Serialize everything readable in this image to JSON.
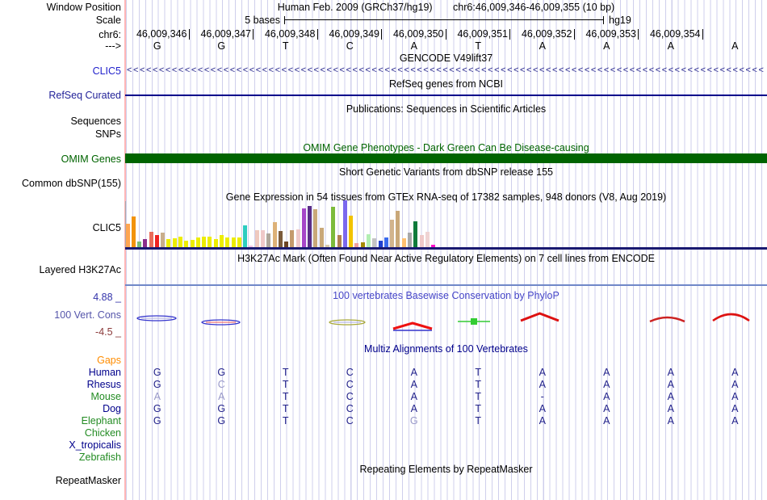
{
  "header": {
    "assembly": "Human Feb. 2009 (GRCh37/hg19)",
    "window": "chr6:46,009,346-46,009,355 (10 bp)"
  },
  "ruler": {
    "scale_text": "5 bases",
    "genome": "hg19",
    "coordinates": [
      "46,009,346",
      "46,009,347",
      "46,009,348",
      "46,009,349",
      "46,009,350",
      "46,009,351",
      "46,009,352",
      "46,009,353",
      "46,009,354"
    ],
    "bases": [
      "G",
      "G",
      "T",
      "C",
      "A",
      "T",
      "A",
      "A",
      "A",
      "A"
    ]
  },
  "left_labels": [
    {
      "id": "window-position",
      "text": "Window Position",
      "color": "#000000",
      "y": 2
    },
    {
      "id": "scale",
      "text": "Scale",
      "color": "#000000",
      "y": 18
    },
    {
      "id": "chrom",
      "text": "chr6:",
      "color": "#000000",
      "y": 36
    },
    {
      "id": "strand",
      "text": "--->",
      "color": "#000000",
      "y": 50
    },
    {
      "id": "clic5-gencode",
      "text": "CLIC5",
      "color": "#2222CC",
      "y": 81
    },
    {
      "id": "refseq-curated",
      "text": "RefSeq Curated",
      "color": "#222299",
      "y": 111
    },
    {
      "id": "sequences",
      "text": "Sequences",
      "color": "#000000",
      "y": 143
    },
    {
      "id": "snps",
      "text": "SNPs",
      "color": "#000000",
      "y": 159
    },
    {
      "id": "omim-genes",
      "text": "OMIM Genes",
      "color": "#006400",
      "y": 190
    },
    {
      "id": "common-dbsnp",
      "text": "Common dbSNP(155)",
      "color": "#000000",
      "y": 220
    },
    {
      "id": "clic5-gtex",
      "text": "CLIC5",
      "color": "#000000",
      "y": 275
    },
    {
      "id": "layered-h3k27ac",
      "text": "Layered H3K27Ac",
      "color": "#000000",
      "y": 327
    },
    {
      "id": "cons-max",
      "text": "4.88 _",
      "color": "#3333AA",
      "y": 361
    },
    {
      "id": "vert-cons",
      "text": "100 Vert. Cons",
      "color": "#5555AA",
      "y": 383
    },
    {
      "id": "cons-min",
      "text": "-4.5 _",
      "color": "#8B3A3A",
      "y": 404
    },
    {
      "id": "repeatmasker",
      "text": "RepeatMasker",
      "color": "#000000",
      "y": 588
    }
  ],
  "track_titles": [
    {
      "id": "gencode",
      "text": "GENCODE V49lift37",
      "color": "#000000",
      "y": 65
    },
    {
      "id": "refseq",
      "text": "RefSeq genes from NCBI",
      "color": "#000000",
      "y": 97
    },
    {
      "id": "publications",
      "text": "Publications: Sequences in Scientific Articles",
      "color": "#000000",
      "y": 128
    },
    {
      "id": "omim",
      "text": "OMIM Gene Phenotypes - Dark Green Can Be Disease-causing",
      "color": "#006400",
      "y": 176
    },
    {
      "id": "dbsnp",
      "text": "Short Genetic Variants from dbSNP release 155",
      "color": "#000000",
      "y": 206
    },
    {
      "id": "gtex",
      "text": "Gene Expression in 54 tissues from GTEx RNA-seq of 17382 samples, 948 donors (V8, Aug 2019)",
      "color": "#000000",
      "y": 237
    },
    {
      "id": "h3k27ac",
      "text": "H3K27Ac Mark (Often Found Near Active Regulatory Elements) on 7 cell lines from ENCODE",
      "color": "#000000",
      "y": 313
    },
    {
      "id": "phylop",
      "text": "100 vertebrates Basewise Conservation by PhyloP",
      "color": "#4545C8",
      "y": 359
    },
    {
      "id": "multiz",
      "text": "Multiz Alignments of 100 Vertebrates",
      "color": "#00008B",
      "y": 425
    },
    {
      "id": "repeat",
      "text": "Repeating Elements by RepeatMasker",
      "color": "#000000",
      "y": 574
    }
  ],
  "gene_track": {
    "name": "CLIC5",
    "arrow_char": "<",
    "arrow_count": 99,
    "color": "#22228B"
  },
  "alignment": {
    "rows": [
      {
        "name": "Gaps",
        "color": "#FF8C00",
        "y": 439,
        "cells": [
          "",
          "",
          "",
          "",
          "",
          "",
          "",
          "",
          "",
          ""
        ]
      },
      {
        "name": "Human",
        "color": "#00008B",
        "y": 454,
        "cells": [
          "G",
          "G",
          "T",
          "C",
          "A",
          "T",
          "A",
          "A",
          "A",
          "A"
        ]
      },
      {
        "name": "Rhesus",
        "color": "#00008B",
        "y": 469,
        "cells": [
          "G",
          "~C",
          "T",
          "C",
          "A",
          "T",
          "A",
          "A",
          "A",
          "A"
        ]
      },
      {
        "name": "Mouse",
        "color": "#228B22",
        "y": 484,
        "cells": [
          "~A",
          "~A",
          "T",
          "C",
          "A",
          "T",
          "-",
          "A",
          "A",
          "A"
        ]
      },
      {
        "name": "Dog",
        "color": "#00008B",
        "y": 499,
        "cells": [
          "G",
          "G",
          "T",
          "C",
          "A",
          "T",
          "A",
          "A",
          "A",
          "A"
        ]
      },
      {
        "name": "Elephant",
        "color": "#228B22",
        "y": 514,
        "cells": [
          "G",
          "G",
          "T",
          "C",
          "~G",
          "T",
          "A",
          "A",
          "A",
          "A"
        ]
      },
      {
        "name": "Chicken",
        "color": "#228B22",
        "y": 529,
        "cells": [
          "",
          "",
          "",
          "",
          "",
          "",
          "",
          "",
          "",
          ""
        ]
      },
      {
        "name": "X_tropicalis",
        "color": "#00008B",
        "y": 544,
        "cells": [
          "",
          "",
          "",
          "",
          "",
          "",
          "",
          "",
          "",
          ""
        ]
      },
      {
        "name": "Zebrafish",
        "color": "#228B22",
        "y": 559,
        "cells": [
          "",
          "",
          "",
          "",
          "",
          "",
          "",
          "",
          "",
          ""
        ]
      }
    ]
  },
  "chart_data": {
    "gtex": {
      "type": "bar",
      "title": "Gene Expression in 54 tissues from GTEx RNA-seq of 17382 samples, 948 donors (V8, Aug 2019)",
      "gene": "CLIC5",
      "note": "values are bar heights as fraction of track height (no numeric axis shown)",
      "bars": [
        [
          "#FFA550",
          0.5
        ],
        [
          "#F2930D",
          0.66
        ],
        [
          "#77BB77",
          0.12
        ],
        [
          "#8B2E8B",
          0.17
        ],
        [
          "#E96B5A",
          0.33
        ],
        [
          "#EE2222",
          0.25
        ],
        [
          "#C9AE8C",
          0.31
        ],
        [
          "#EDED00",
          0.17
        ],
        [
          "#EDED00",
          0.19
        ],
        [
          "#EDED00",
          0.22
        ],
        [
          "#EDED00",
          0.13
        ],
        [
          "#EDED00",
          0.15
        ],
        [
          "#EDED00",
          0.21
        ],
        [
          "#EDED00",
          0.23
        ],
        [
          "#EDED00",
          0.23
        ],
        [
          "#EDED00",
          0.18
        ],
        [
          "#EDED00",
          0.26
        ],
        [
          "#EDED00",
          0.2
        ],
        [
          "#EDED00",
          0.2
        ],
        [
          "#EDED00",
          0.21
        ],
        [
          "#2DCDC0",
          0.47
        ],
        [
          "#F6C6E6",
          0.04
        ],
        [
          "#EFC9BE",
          0.37
        ],
        [
          "#EFC9C9",
          0.36
        ],
        [
          "#AFA79B",
          0.29
        ],
        [
          "#DDB177",
          0.53
        ],
        [
          "#7B5B3B",
          0.34
        ],
        [
          "#6B4423",
          0.12
        ],
        [
          "#C49A6C",
          0.37
        ],
        [
          "#EFC9C9",
          0.38
        ],
        [
          "#A646C8",
          0.82
        ],
        [
          "#5A2D88",
          0.88
        ],
        [
          "#C9A878",
          0.81
        ],
        [
          "#C9A878",
          0.41
        ],
        [
          "#D9C9A9",
          0.05
        ],
        [
          "#7CBB3C",
          0.87
        ],
        [
          "#B08050",
          0.25
        ],
        [
          "#7B68EE",
          1.0
        ],
        [
          "#F2C300",
          0.67
        ],
        [
          "#F0A0A0",
          0.09
        ],
        [
          "#A58A00",
          0.1
        ],
        [
          "#B2EEB2",
          0.27
        ],
        [
          "#C4C4C4",
          0.19
        ],
        [
          "#2041D0",
          0.13
        ],
        [
          "#3A6AEE",
          0.2
        ],
        [
          "#D2B48C",
          0.58
        ],
        [
          "#C9A878",
          0.78
        ],
        [
          "#FFC070",
          0.19
        ],
        [
          "#A8A8A8",
          0.31
        ],
        [
          "#0F7B3A",
          0.56
        ],
        [
          "#EFC9C9",
          0.25
        ],
        [
          "#EFD3D3",
          0.32
        ],
        [
          "#FF10C8",
          0.05
        ]
      ]
    },
    "phylop": {
      "type": "area",
      "title": "100 vertebrates Basewise Conservation by PhyloP",
      "ylim": [
        -4.5,
        4.88
      ],
      "glyphs": [
        {
          "shape": "lens",
          "x": 170,
          "w": 48,
          "y": 394,
          "stroke": "#3333CC"
        },
        {
          "shape": "lens",
          "x": 250,
          "w": 47,
          "y": 399,
          "stroke": "#3333CC",
          "inner": "#EE5555"
        },
        {
          "shape": "lens",
          "x": 408,
          "w": 44,
          "y": 399,
          "stroke": "#A8A838"
        },
        {
          "shape": "peak",
          "x": 487,
          "w": 48,
          "y": 407,
          "rise": 7,
          "stroke": "#EE1111",
          "base": "#3333CC"
        },
        {
          "shape": "marker",
          "x": 567,
          "w": 40,
          "y": 398,
          "stroke": "#33CC33"
        },
        {
          "shape": "peak",
          "x": 645,
          "w": 47,
          "y": 397,
          "rise": 9,
          "stroke": "#DD1111"
        },
        {
          "shape": "arc",
          "x": 805,
          "w": 43,
          "y": 398,
          "rise": 5,
          "stroke": "#CC2222"
        },
        {
          "shape": "arc",
          "x": 883,
          "w": 45,
          "y": 397,
          "rise": 8,
          "stroke": "#DD1111"
        }
      ]
    }
  },
  "colors": {
    "gridline": "#CFCFEC",
    "left_boundary": "#FFB6B6",
    "gene_navy": "#22228B",
    "refseq_line": "#00008B",
    "omim_green": "#006400",
    "gtex_baseline": "#191970",
    "h3k27ac_line": "#7088C8",
    "dim_letter": "#9898C8"
  }
}
